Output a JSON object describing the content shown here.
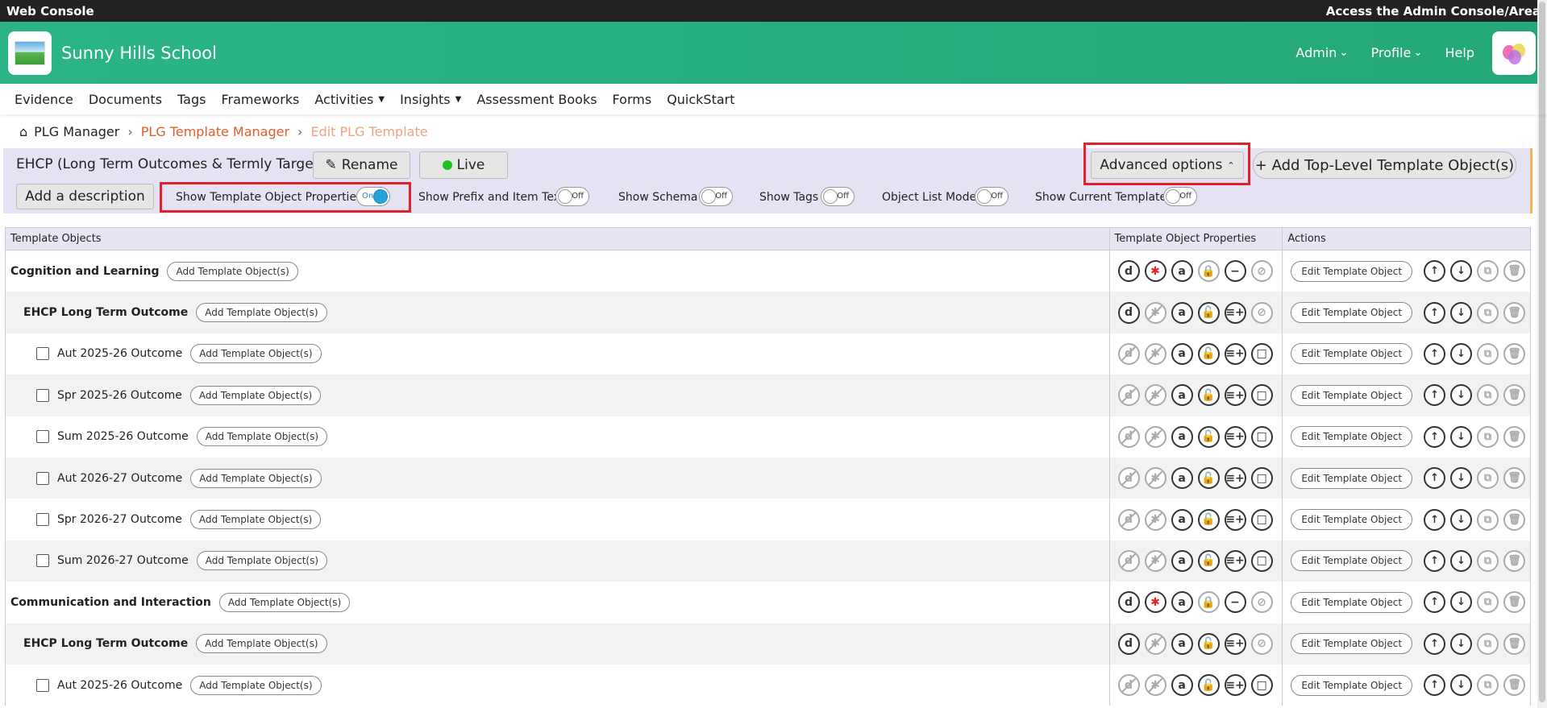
{
  "topbar": {
    "left": "Web Console",
    "right": "Access the Admin Console/Area"
  },
  "header": {
    "school": "Sunny Hills School",
    "nav": [
      "Admin",
      "Profile",
      "Help"
    ]
  },
  "menu": {
    "items": [
      "Evidence",
      "Documents",
      "Tags",
      "Frameworks",
      "Activities",
      "Insights",
      "Assessment Books",
      "Forms",
      "QuickStart"
    ]
  },
  "breadcrumb": {
    "home": "PLG Manager",
    "middle": "PLG Template Manager",
    "current": "Edit PLG Template"
  },
  "template": {
    "title": "EHCP (Long Term Outcomes & Termly Targets)",
    "rename": "Rename",
    "live": "Live",
    "advanced": "Advanced options",
    "add_top": "+ Add Top-Level Template Object(s)",
    "add_desc": "Add a description"
  },
  "toggles": [
    {
      "label": "Show Template Object Properties",
      "state": "On"
    },
    {
      "label": "Show Prefix and Item Text",
      "state": "Off"
    },
    {
      "label": "Show Schema",
      "state": "Off"
    },
    {
      "label": "Show Tags",
      "state": "Off"
    },
    {
      "label": "Object List Mode",
      "state": "Off"
    },
    {
      "label": "Show Current Template",
      "state": "Off"
    }
  ],
  "table": {
    "headers": [
      "Template Objects",
      "Template Object Properties",
      "Actions"
    ],
    "add_label": "Add Template Object(s)",
    "edit_label": "Edit Template Object",
    "rows": [
      {
        "name": "Cognition and Learning",
        "level": 0
      },
      {
        "name": "EHCP Long Term Outcome",
        "level": 1
      },
      {
        "name": "Aut 2025-26 Outcome",
        "level": 2
      },
      {
        "name": "Spr 2025-26 Outcome",
        "level": 2
      },
      {
        "name": "Sum 2025-26 Outcome",
        "level": 2
      },
      {
        "name": "Aut 2026-27 Outcome",
        "level": 2
      },
      {
        "name": "Spr 2026-27 Outcome",
        "level": 2
      },
      {
        "name": "Sum 2026-27 Outcome",
        "level": 2
      },
      {
        "name": "Communication and Interaction",
        "level": 0
      },
      {
        "name": "EHCP Long Term Outcome",
        "level": 1
      },
      {
        "name": "Aut 2025-26 Outcome",
        "level": 2
      }
    ]
  }
}
